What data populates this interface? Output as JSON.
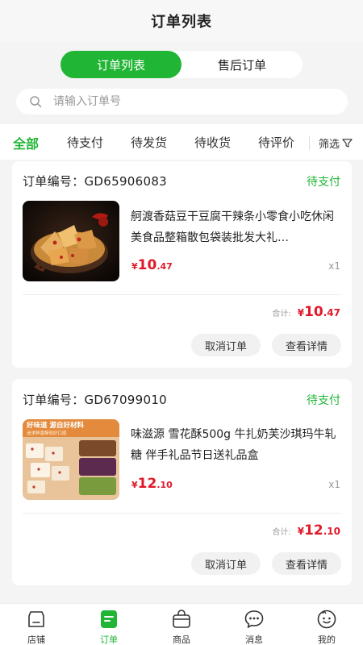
{
  "header": {
    "title": "订单列表"
  },
  "segment": {
    "options": [
      "订单列表",
      "售后订单"
    ],
    "active": 0
  },
  "search": {
    "placeholder": "请输入订单号",
    "value": ""
  },
  "tabs": {
    "items": [
      "全部",
      "待支付",
      "待发货",
      "待收货",
      "待评价"
    ],
    "active": 0,
    "filter_label": "筛选"
  },
  "orders": [
    {
      "order_label": "订单编号：GD65906083",
      "status": "待支付",
      "product_name": "舸渡香菇豆干豆腐干辣条小零食小吃休闲美食品整箱散包袋装批发大礼…",
      "price_currency": "¥",
      "price_int": "10",
      "price_dec": ".47",
      "qty": "x1",
      "total_label": "合计:",
      "total_currency": "¥",
      "total_int": "10",
      "total_dec": ".47",
      "cancel_label": "取消订单",
      "detail_label": "查看详情"
    },
    {
      "order_label": "订单编号：GD67099010",
      "status": "待支付",
      "product_name": "味滋源 雪花酥500g 牛扎奶芙沙琪玛牛轧糖 伴手礼品节日送礼品盒",
      "image_text_1": "好味道 源自好材料",
      "image_text_2": "追求鲜香酥软好口感",
      "price_currency": "¥",
      "price_int": "12",
      "price_dec": ".10",
      "qty": "x1",
      "total_label": "合计:",
      "total_currency": "¥",
      "total_int": "12",
      "total_dec": ".10",
      "cancel_label": "取消订单",
      "detail_label": "查看详情"
    }
  ],
  "tabbar": {
    "items": [
      {
        "label": "店铺",
        "icon": "store-icon"
      },
      {
        "label": "订单",
        "icon": "order-icon"
      },
      {
        "label": "商品",
        "icon": "bag-icon"
      },
      {
        "label": "消息",
        "icon": "message-icon"
      },
      {
        "label": "我的",
        "icon": "profile-icon"
      }
    ],
    "active": 1
  },
  "colors": {
    "accent": "#21b535",
    "price": "#e0192a"
  }
}
